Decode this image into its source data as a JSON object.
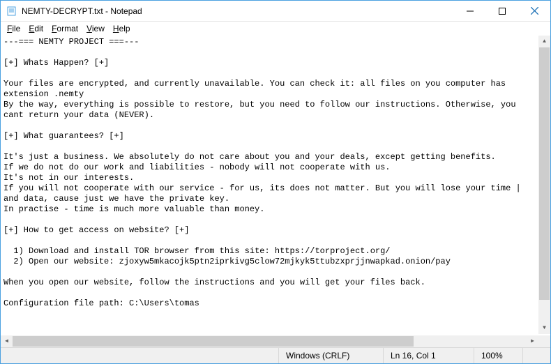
{
  "window": {
    "title": "NEMTY-DECRYPT.txt - Notepad"
  },
  "menu": {
    "file": "File",
    "edit": "Edit",
    "format": "Format",
    "view": "View",
    "help": "Help"
  },
  "document": {
    "text": "---=== NEMTY PROJECT ===---\n\n[+] Whats Happen? [+]\n\nYour files are encrypted, and currently unavailable. You can check it: all files on you computer has extension .nemty\nBy the way, everything is possible to restore, but you need to follow our instructions. Otherwise, you cant return your data (NEVER).\n\n[+] What guarantees? [+]\n\nIt's just a business. We absolutely do not care about you and your deals, except getting benefits.\nIf we do not do our work and liabilities - nobody will not cooperate with us.\nIt's not in our interests.\nIf you will not cooperate with our service - for us, its does not matter. But you will lose your time | and data, cause just we have the private key.\nIn practise - time is much more valuable than money.\n\n[+] How to get access on website? [+]\n\n  1) Download and install TOR browser from this site: https://torproject.org/\n  2) Open our website: zjoxyw5mkacojk5ptn2iprkivg5clow72mjkyk5ttubzxprjjnwapkad.onion/pay\n\nWhen you open our website, follow the instructions and you will get your files back.\n\nConfiguration file path: C:\\Users\\tomas"
  },
  "statusbar": {
    "encoding_mode": "Windows (CRLF)",
    "cursor": "Ln 16, Col 1",
    "zoom": "100%"
  }
}
